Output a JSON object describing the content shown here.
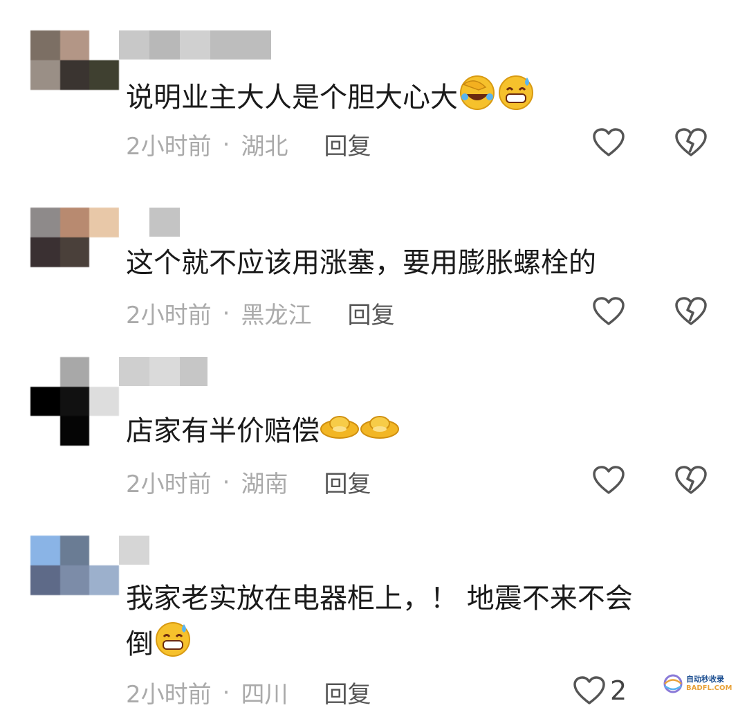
{
  "comments": [
    {
      "text": "说明业主大人是个胆大心大",
      "emojis": [
        "facepalm-laugh-emoji",
        "grin-sweat-emoji"
      ],
      "time": "2小时前",
      "location": "湖北",
      "reply": "回复"
    },
    {
      "text": "这个就不应该用涨塞，要用膨胀螺栓的",
      "emojis": [],
      "time": "2小时前",
      "location": "黑龙江",
      "reply": "回复"
    },
    {
      "text": "店家有半价赔偿",
      "emojis": [
        "gold-ingot-emoji",
        "gold-ingot-emoji"
      ],
      "time": "2小时前",
      "location": "湖南",
      "reply": "回复"
    },
    {
      "text_line1": "我家老实放在电器柜上，！ 地震不来不会",
      "text_line2": "倒",
      "emojis": [
        "grin-sweat-emoji"
      ],
      "time": "2小时前",
      "location": "四川",
      "reply": "回复",
      "like_count": "2"
    }
  ],
  "separator": "·",
  "watermark": {
    "line1": "自动秒收录",
    "line2": "BADFL.COM"
  },
  "colors": {
    "text": "#1a1a1a",
    "meta": "#aaaaaa",
    "reply": "#555555",
    "icon": "#555555"
  }
}
